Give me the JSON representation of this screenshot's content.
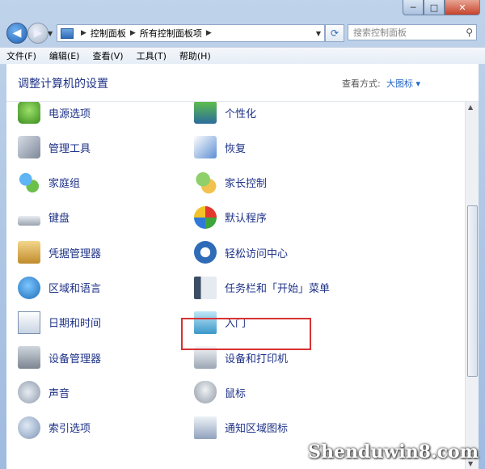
{
  "address": {
    "segments": [
      "控制面板",
      "所有控制面板项"
    ]
  },
  "search": {
    "placeholder": "搜索控制面板"
  },
  "menu": [
    "文件(F)",
    "编辑(E)",
    "查看(V)",
    "工具(T)",
    "帮助(H)"
  ],
  "header": {
    "title": "调整计算机的设置",
    "view_label": "查看方式:",
    "view_value": "大图标"
  },
  "items_left": [
    {
      "label": "电源选项",
      "icon": "power-options-icon"
    },
    {
      "label": "管理工具",
      "icon": "admin-tools-icon"
    },
    {
      "label": "家庭组",
      "icon": "homegroup-icon"
    },
    {
      "label": "键盘",
      "icon": "keyboard-icon"
    },
    {
      "label": "凭据管理器",
      "icon": "credential-manager-icon"
    },
    {
      "label": "区域和语言",
      "icon": "region-language-icon"
    },
    {
      "label": "日期和时间",
      "icon": "date-time-icon"
    },
    {
      "label": "设备管理器",
      "icon": "device-manager-icon"
    },
    {
      "label": "声音",
      "icon": "sound-icon"
    },
    {
      "label": "索引选项",
      "icon": "indexing-options-icon"
    }
  ],
  "items_right": [
    {
      "label": "个性化",
      "icon": "personalization-icon"
    },
    {
      "label": "恢复",
      "icon": "recovery-icon"
    },
    {
      "label": "家长控制",
      "icon": "parental-controls-icon"
    },
    {
      "label": "默认程序",
      "icon": "default-programs-icon"
    },
    {
      "label": "轻松访问中心",
      "icon": "ease-of-access-icon"
    },
    {
      "label": "任务栏和「开始」菜单",
      "icon": "taskbar-start-menu-icon"
    },
    {
      "label": "入门",
      "icon": "getting-started-icon"
    },
    {
      "label": "设备和打印机",
      "icon": "devices-printers-icon"
    },
    {
      "label": "鼠标",
      "icon": "mouse-icon"
    },
    {
      "label": "通知区域图标",
      "icon": "notification-area-icon"
    }
  ],
  "colors": {
    "link": "#1e3287",
    "highlight_border": "#d93232",
    "view_value": "#1e64c8"
  },
  "watermark": "Shenduwin8.com"
}
